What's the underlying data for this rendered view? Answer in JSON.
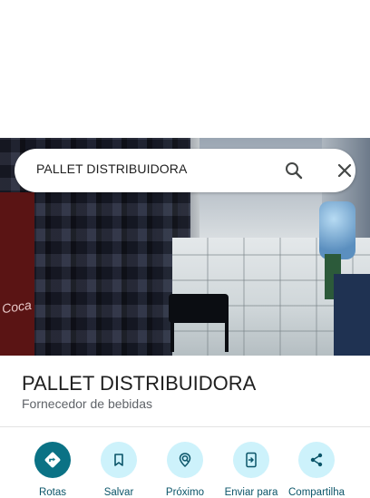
{
  "search": {
    "query": "PALLET DISTRIBUIDORA"
  },
  "hero": {
    "photo_logo_text": "Coca"
  },
  "place": {
    "name": "PALLET DISTRIBUIDORA",
    "category": "Fornecedor de bebidas"
  },
  "actions": [
    {
      "label": "Rotas",
      "icon": "directions-icon"
    },
    {
      "label": "Salvar",
      "icon": "bookmark-icon"
    },
    {
      "label": "Próximo",
      "icon": "nearby-icon"
    },
    {
      "label": "Enviar para",
      "icon": "send-to-phone-icon"
    },
    {
      "label": "Compartilha",
      "icon": "share-icon"
    }
  ],
  "colors": {
    "accent": "#0b7285",
    "action_bg": "#cdf2fb",
    "action_text": "#0b5569"
  }
}
